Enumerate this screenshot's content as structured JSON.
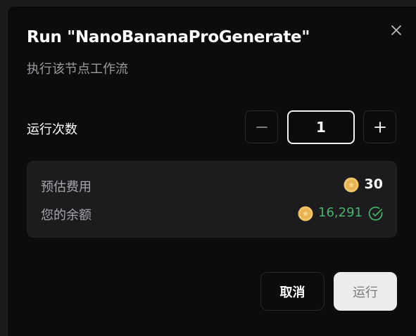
{
  "dialog": {
    "title": "Run \"NanoBananaProGenerate\"",
    "subtitle": "执行该节点工作流",
    "close_icon": "close-icon"
  },
  "run_count": {
    "label": "运行次数",
    "value": "1",
    "decrement_icon": "minus-icon",
    "increment_icon": "plus-icon"
  },
  "cost": {
    "estimate_label": "预估费用",
    "estimate_value": "30",
    "balance_label": "您的余额",
    "balance_value": "16,291",
    "coin_icon": "coin-icon",
    "balance_status_icon": "check-circle-icon",
    "balance_color": "#46b36a",
    "coin_color": "#f2c46a"
  },
  "actions": {
    "cancel_label": "取消",
    "run_label": "运行"
  }
}
